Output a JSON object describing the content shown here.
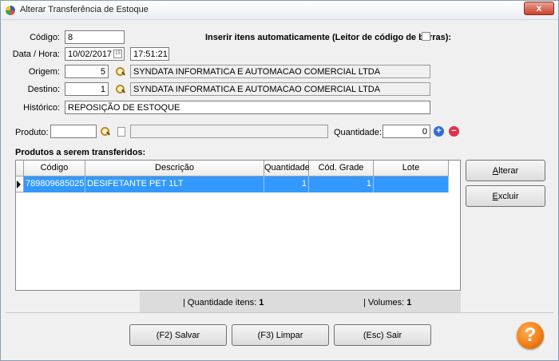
{
  "window": {
    "title": "Alterar Transferência de Estoque",
    "close_label": "x"
  },
  "form": {
    "codigo_label": "Código:",
    "codigo_value": "8",
    "data_hora_label": "Data / Hora:",
    "data_value": "10/02/2017",
    "hora_value": "17:51:21",
    "calendar_icon_text": "15",
    "inserir_label": "Inserir itens automaticamente (Leitor de código de barras):",
    "inserir_checked": false,
    "origem_label": "Origem:",
    "origem_code": "5",
    "origem_name": "SYNDATA INFORMATICA E AUTOMACAO COMERCIAL LTDA",
    "destino_label": "Destino:",
    "destino_code": "1",
    "destino_name": "SYNDATA INFORMATICA E AUTOMACAO COMERCIAL LTDA",
    "historico_label": "Histórico:",
    "historico_value": "REPOSIÇÃO DE ESTOQUE",
    "produto_label": "Produto:",
    "produto_code": "",
    "produto_desc": "",
    "quantidade_label": "Quantidade:",
    "quantidade_value": "0"
  },
  "grid": {
    "title": "Produtos a serem transferidos:",
    "columns": [
      "Código",
      "Descrição",
      "Quantidade",
      "Cód. Grade",
      "Lote"
    ],
    "rows": [
      {
        "codigo": "7898096850257",
        "descricao": "DESIFETANTE PET 1LT",
        "quantidade": "1",
        "cod_grade": "1",
        "lote": ""
      }
    ]
  },
  "side_buttons": {
    "alterar": "Alterar",
    "excluir": "Excluir"
  },
  "summary": {
    "qtd_itens_label": "| Quantidade itens:",
    "qtd_itens_value": "1",
    "volumes_label": "| Volumes:",
    "volumes_value": "1"
  },
  "bottom_buttons": {
    "salvar": "(F2) Salvar",
    "limpar": "(F3) Limpar",
    "sair": "(Esc) Sair"
  },
  "help": {
    "label": "?"
  },
  "colors": {
    "selection": "#3399ff",
    "help_orange": "#f07a10",
    "add_blue": "#2f6fd6",
    "remove_red": "#e0304a"
  },
  "icons": {
    "search": "search-icon",
    "calendar": "calendar-icon",
    "document": "document-icon",
    "add": "plus-circle-icon",
    "remove": "minus-circle-icon",
    "help": "help-icon"
  }
}
